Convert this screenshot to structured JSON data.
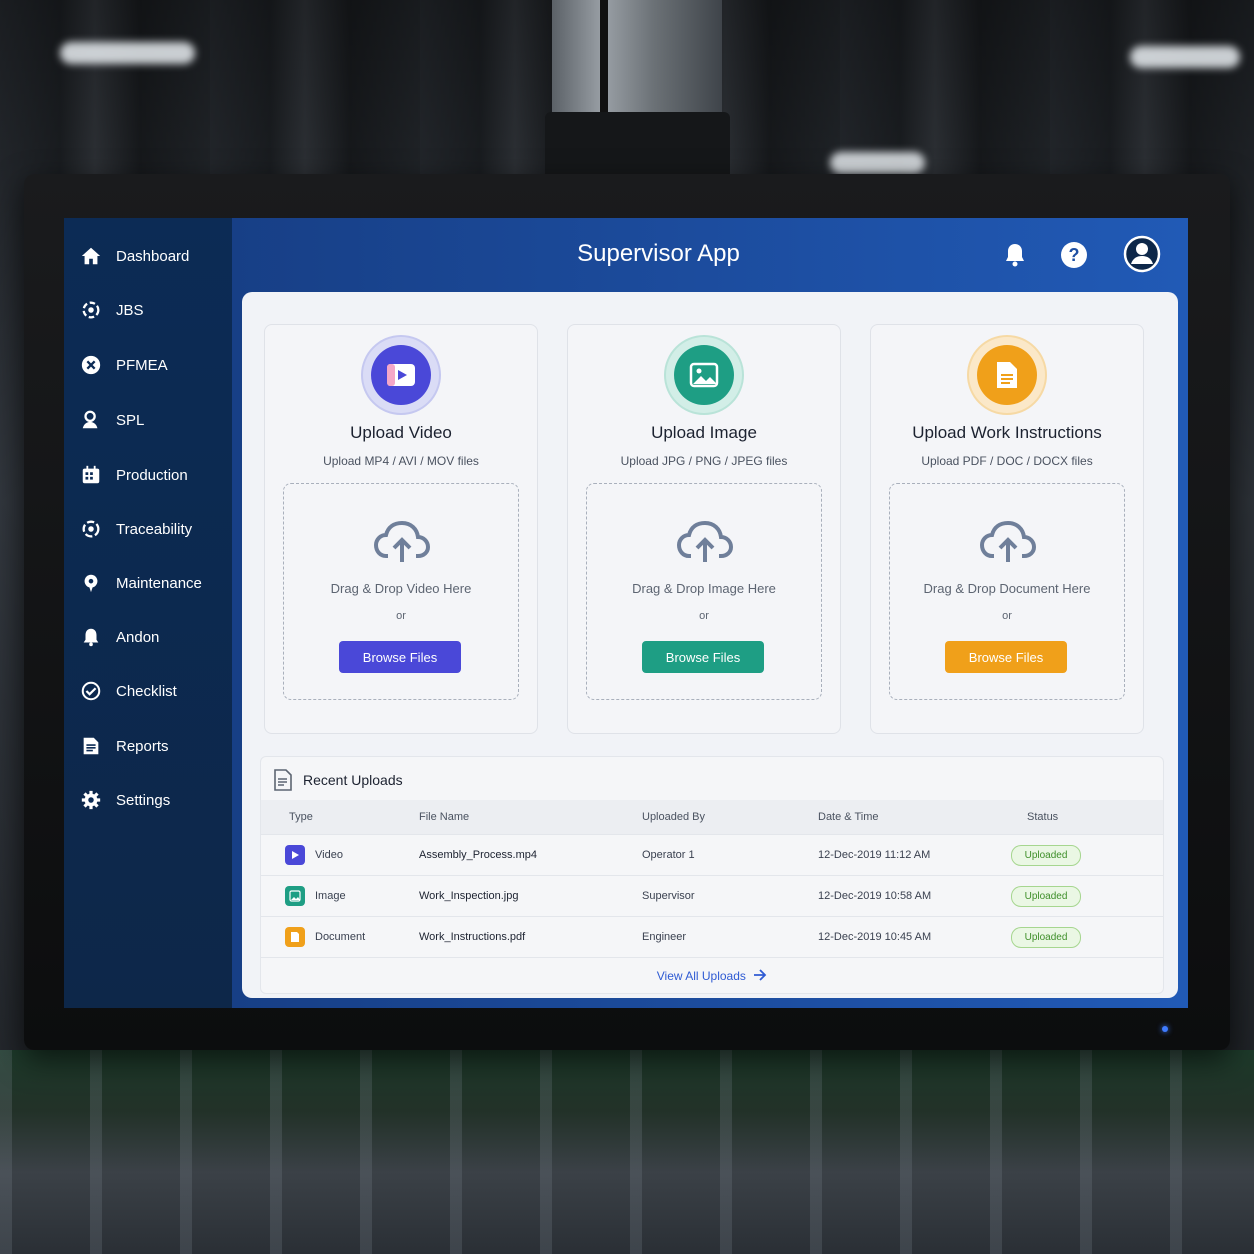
{
  "app": {
    "title": "Supervisor App"
  },
  "sidebar": {
    "items": [
      {
        "label": "Dashboard",
        "icon": "home-icon"
      },
      {
        "label": "JBS",
        "icon": "jbs-icon"
      },
      {
        "label": "PFMEA",
        "icon": "pfmea-icon"
      },
      {
        "label": "SPL",
        "icon": "spl-icon"
      },
      {
        "label": "Production",
        "icon": "production-icon"
      },
      {
        "label": "Traceability",
        "icon": "traceability-icon"
      },
      {
        "label": "Maintenance",
        "icon": "maintenance-icon"
      },
      {
        "label": "Andon",
        "icon": "andon-icon"
      },
      {
        "label": "Checklist",
        "icon": "checklist-icon"
      },
      {
        "label": "Reports",
        "icon": "reports-icon"
      },
      {
        "label": "Settings",
        "icon": "settings-icon"
      }
    ]
  },
  "header": {
    "icons": [
      "bell-icon",
      "help-icon",
      "user-avatar-icon"
    ]
  },
  "cards": [
    {
      "title": "Upload Video",
      "subtitle": "Upload MP4 / AVI / MOV files",
      "drop_text": "Drag & Drop Video Here",
      "or": "or",
      "button": "Browse Files",
      "color": "#4a48d8",
      "icon": "video-icon"
    },
    {
      "title": "Upload Image",
      "subtitle": "Upload JPG / PNG / JPEG files",
      "drop_text": "Drag & Drop Image Here",
      "or": "or",
      "button": "Browse Files",
      "color": "#1e9e84",
      "icon": "image-icon"
    },
    {
      "title": "Upload Work Instructions",
      "subtitle": "Upload PDF / DOC / DOCX files",
      "drop_text": "Drag & Drop Document Here",
      "or": "or",
      "button": "Browse Files",
      "color": "#f0a01a",
      "icon": "document-icon"
    }
  ],
  "recent": {
    "title": "Recent Uploads",
    "columns": [
      "Type",
      "File Name",
      "Uploaded By",
      "Date & Time",
      "Status"
    ],
    "rows": [
      {
        "type": "Video",
        "file": "Assembly_Process.mp4",
        "by": "Operator 1",
        "date": "12-Dec-2019 11:12 AM",
        "status": "Uploaded"
      },
      {
        "type": "Image",
        "file": "Work_Inspection.jpg",
        "by": "Supervisor",
        "date": "12-Dec-2019 10:58 AM",
        "status": "Uploaded"
      },
      {
        "type": "Document",
        "file": "Work_Instructions.pdf",
        "by": "Engineer",
        "date": "12-Dec-2019 10:45 AM",
        "status": "Uploaded"
      }
    ],
    "view_all": "View All Uploads"
  }
}
